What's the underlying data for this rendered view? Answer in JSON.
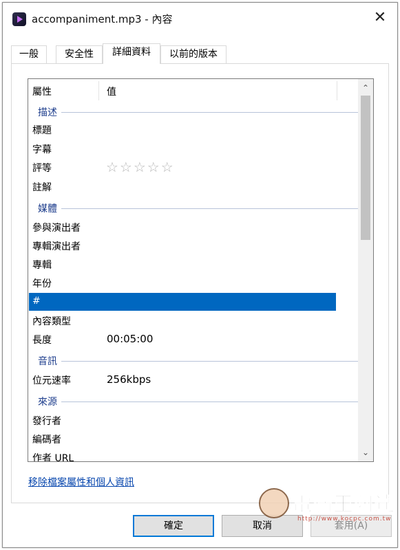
{
  "window": {
    "title": "accompaniment.mp3 - 內容",
    "close_glyph": "✕"
  },
  "tabs": [
    {
      "label": "一般"
    },
    {
      "label": "安全性"
    },
    {
      "label": "詳細資料"
    },
    {
      "label": "以前的版本"
    }
  ],
  "active_tab": "詳細資料",
  "list": {
    "headers": {
      "property": "屬性",
      "value": "值"
    },
    "sections": {
      "description": "描述",
      "media": "媒體",
      "audio": "音訊",
      "origin": "來源"
    },
    "rows": {
      "title": {
        "name": "標題",
        "value": ""
      },
      "subtitle": {
        "name": "字幕",
        "value": ""
      },
      "rating": {
        "name": "評等",
        "value": "☆☆☆☆☆"
      },
      "comments": {
        "name": "註解",
        "value": ""
      },
      "contributing_artists": {
        "name": "參與演出者",
        "value": ""
      },
      "album_artist": {
        "name": "專輯演出者",
        "value": ""
      },
      "album": {
        "name": "專輯",
        "value": ""
      },
      "year": {
        "name": "年份",
        "value": ""
      },
      "track": {
        "name": "#",
        "value": ""
      },
      "genre": {
        "name": "內容類型",
        "value": ""
      },
      "length": {
        "name": "長度",
        "value": "00:05:00"
      },
      "bit_rate": {
        "name": "位元速率",
        "value": "256kbps"
      },
      "publisher": {
        "name": "發行者",
        "value": ""
      },
      "encoded_by": {
        "name": "編碼者",
        "value": ""
      },
      "author_url": {
        "name": "作者 URL",
        "value": ""
      }
    },
    "selected_row": "#",
    "rating_stars": 0
  },
  "remove_link": "移除檔案屬性和個人資訊",
  "buttons": {
    "ok": "確定",
    "cancel": "取消",
    "apply": "套用(A)"
  },
  "watermark": {
    "brand": "電腦王阿達",
    "url": "http://www.kocpc.com.tw"
  },
  "colors": {
    "selection": "#0067c0",
    "section_text": "#1d3d8c",
    "link": "#0645ad",
    "default_button_border": "#0078d7"
  }
}
